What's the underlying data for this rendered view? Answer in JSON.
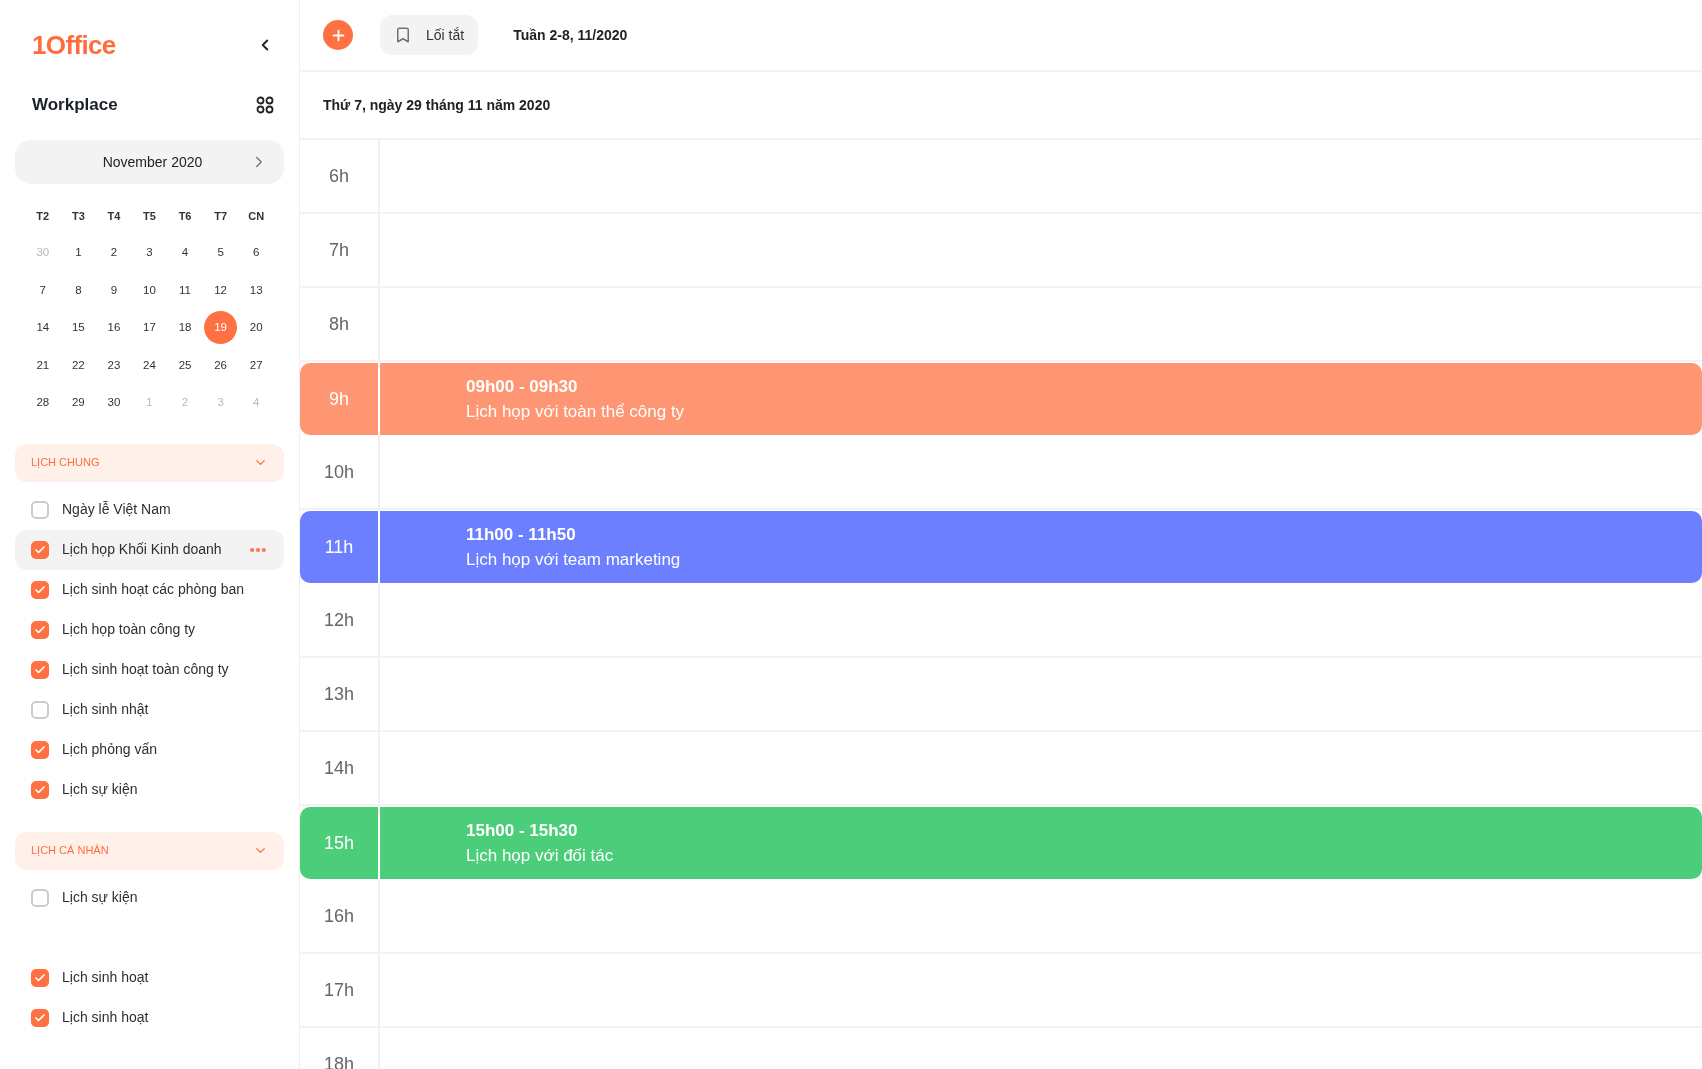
{
  "logo": "1Office",
  "workspace": {
    "title": "Workplace"
  },
  "mini_calendar": {
    "month": "November 2020",
    "weekdays": [
      "T2",
      "T3",
      "T4",
      "T5",
      "T6",
      "T7",
      "CN"
    ],
    "weeks": [
      [
        {
          "day": "30",
          "muted": true,
          "selected": false
        },
        {
          "day": "1",
          "muted": false,
          "selected": false
        },
        {
          "day": "2",
          "muted": false,
          "selected": false
        },
        {
          "day": "3",
          "muted": false,
          "selected": false
        },
        {
          "day": "4",
          "muted": false,
          "selected": false
        },
        {
          "day": "5",
          "muted": false,
          "selected": false
        },
        {
          "day": "6",
          "muted": false,
          "selected": false
        }
      ],
      [
        {
          "day": "7",
          "muted": false,
          "selected": false
        },
        {
          "day": "8",
          "muted": false,
          "selected": false
        },
        {
          "day": "9",
          "muted": false,
          "selected": false
        },
        {
          "day": "10",
          "muted": false,
          "selected": false
        },
        {
          "day": "11",
          "muted": false,
          "selected": false
        },
        {
          "day": "12",
          "muted": false,
          "selected": false
        },
        {
          "day": "13",
          "muted": false,
          "selected": false
        }
      ],
      [
        {
          "day": "14",
          "muted": false,
          "selected": false
        },
        {
          "day": "15",
          "muted": false,
          "selected": false
        },
        {
          "day": "16",
          "muted": false,
          "selected": false
        },
        {
          "day": "17",
          "muted": false,
          "selected": false
        },
        {
          "day": "18",
          "muted": false,
          "selected": false
        },
        {
          "day": "19",
          "muted": false,
          "selected": true
        },
        {
          "day": "20",
          "muted": false,
          "selected": false
        }
      ],
      [
        {
          "day": "21",
          "muted": false,
          "selected": false
        },
        {
          "day": "22",
          "muted": false,
          "selected": false
        },
        {
          "day": "23",
          "muted": false,
          "selected": false
        },
        {
          "day": "24",
          "muted": false,
          "selected": false
        },
        {
          "day": "25",
          "muted": false,
          "selected": false
        },
        {
          "day": "26",
          "muted": false,
          "selected": false
        },
        {
          "day": "27",
          "muted": false,
          "selected": false
        }
      ],
      [
        {
          "day": "28",
          "muted": false,
          "selected": false
        },
        {
          "day": "29",
          "muted": false,
          "selected": false
        },
        {
          "day": "30",
          "muted": false,
          "selected": false
        },
        {
          "day": "1",
          "muted": true,
          "selected": false
        },
        {
          "day": "2",
          "muted": true,
          "selected": false
        },
        {
          "day": "3",
          "muted": true,
          "selected": false
        },
        {
          "day": "4",
          "muted": true,
          "selected": false
        }
      ]
    ]
  },
  "sections": [
    {
      "title": "LỊCH CHUNG",
      "expanded": true,
      "groups": [
        [
          {
            "label": "Ngày lễ Việt Nam",
            "checked": false,
            "selected": false
          },
          {
            "label": "Lịch họp Khối Kinh doanh",
            "checked": true,
            "selected": true
          },
          {
            "label": "Lịch sinh hoạt các phòng ban",
            "checked": true,
            "selected": false
          },
          {
            "label": "Lịch họp toàn công ty",
            "checked": true,
            "selected": false
          },
          {
            "label": "Lịch sinh hoạt toàn công ty",
            "checked": true,
            "selected": false
          },
          {
            "label": "Lịch sinh nhật",
            "checked": false,
            "selected": false
          },
          {
            "label": "Lịch phỏng vấn",
            "checked": true,
            "selected": false
          },
          {
            "label": "Lịch sự kiện",
            "checked": true,
            "selected": false
          }
        ]
      ]
    },
    {
      "title": "LỊCH CÁ NHÂN",
      "expanded": true,
      "groups": [
        [
          {
            "label": "Lịch sự kiện",
            "checked": false,
            "selected": false
          }
        ],
        [
          {
            "label": "Lịch sinh hoạt",
            "checked": true,
            "selected": false
          },
          {
            "label": "Lịch sinh hoạt",
            "checked": true,
            "selected": false
          }
        ]
      ]
    }
  ],
  "toolbar": {
    "shortcut_label": "Lối tắt",
    "week": "Tuần 2-8, 11/2020"
  },
  "day_header": "Thứ 7, ngày 29 tháng 11 năm 2020",
  "rows": [
    {
      "kind": "hour",
      "hour": "6h"
    },
    {
      "kind": "hour",
      "hour": "7h"
    },
    {
      "kind": "hour",
      "hour": "8h"
    },
    {
      "kind": "event",
      "hour": "9h",
      "time": "09h00 - 09h30",
      "title": "Lịch họp với toàn thể công ty",
      "color": "#ff9673"
    },
    {
      "kind": "hour",
      "hour": "10h"
    },
    {
      "kind": "event",
      "hour": "11h",
      "time": "11h00 - 11h50",
      "title": "Lịch họp với team marketing",
      "color": "#6b7fff"
    },
    {
      "kind": "hour",
      "hour": "12h"
    },
    {
      "kind": "hour",
      "hour": "13h"
    },
    {
      "kind": "hour",
      "hour": "14h"
    },
    {
      "kind": "event",
      "hour": "15h",
      "time": "15h00 - 15h30",
      "title": "Lịch họp với đối tác",
      "color": "#4ccd7a"
    },
    {
      "kind": "hour",
      "hour": "16h"
    },
    {
      "kind": "hour",
      "hour": "17h"
    },
    {
      "kind": "hour",
      "hour": "18h"
    }
  ]
}
